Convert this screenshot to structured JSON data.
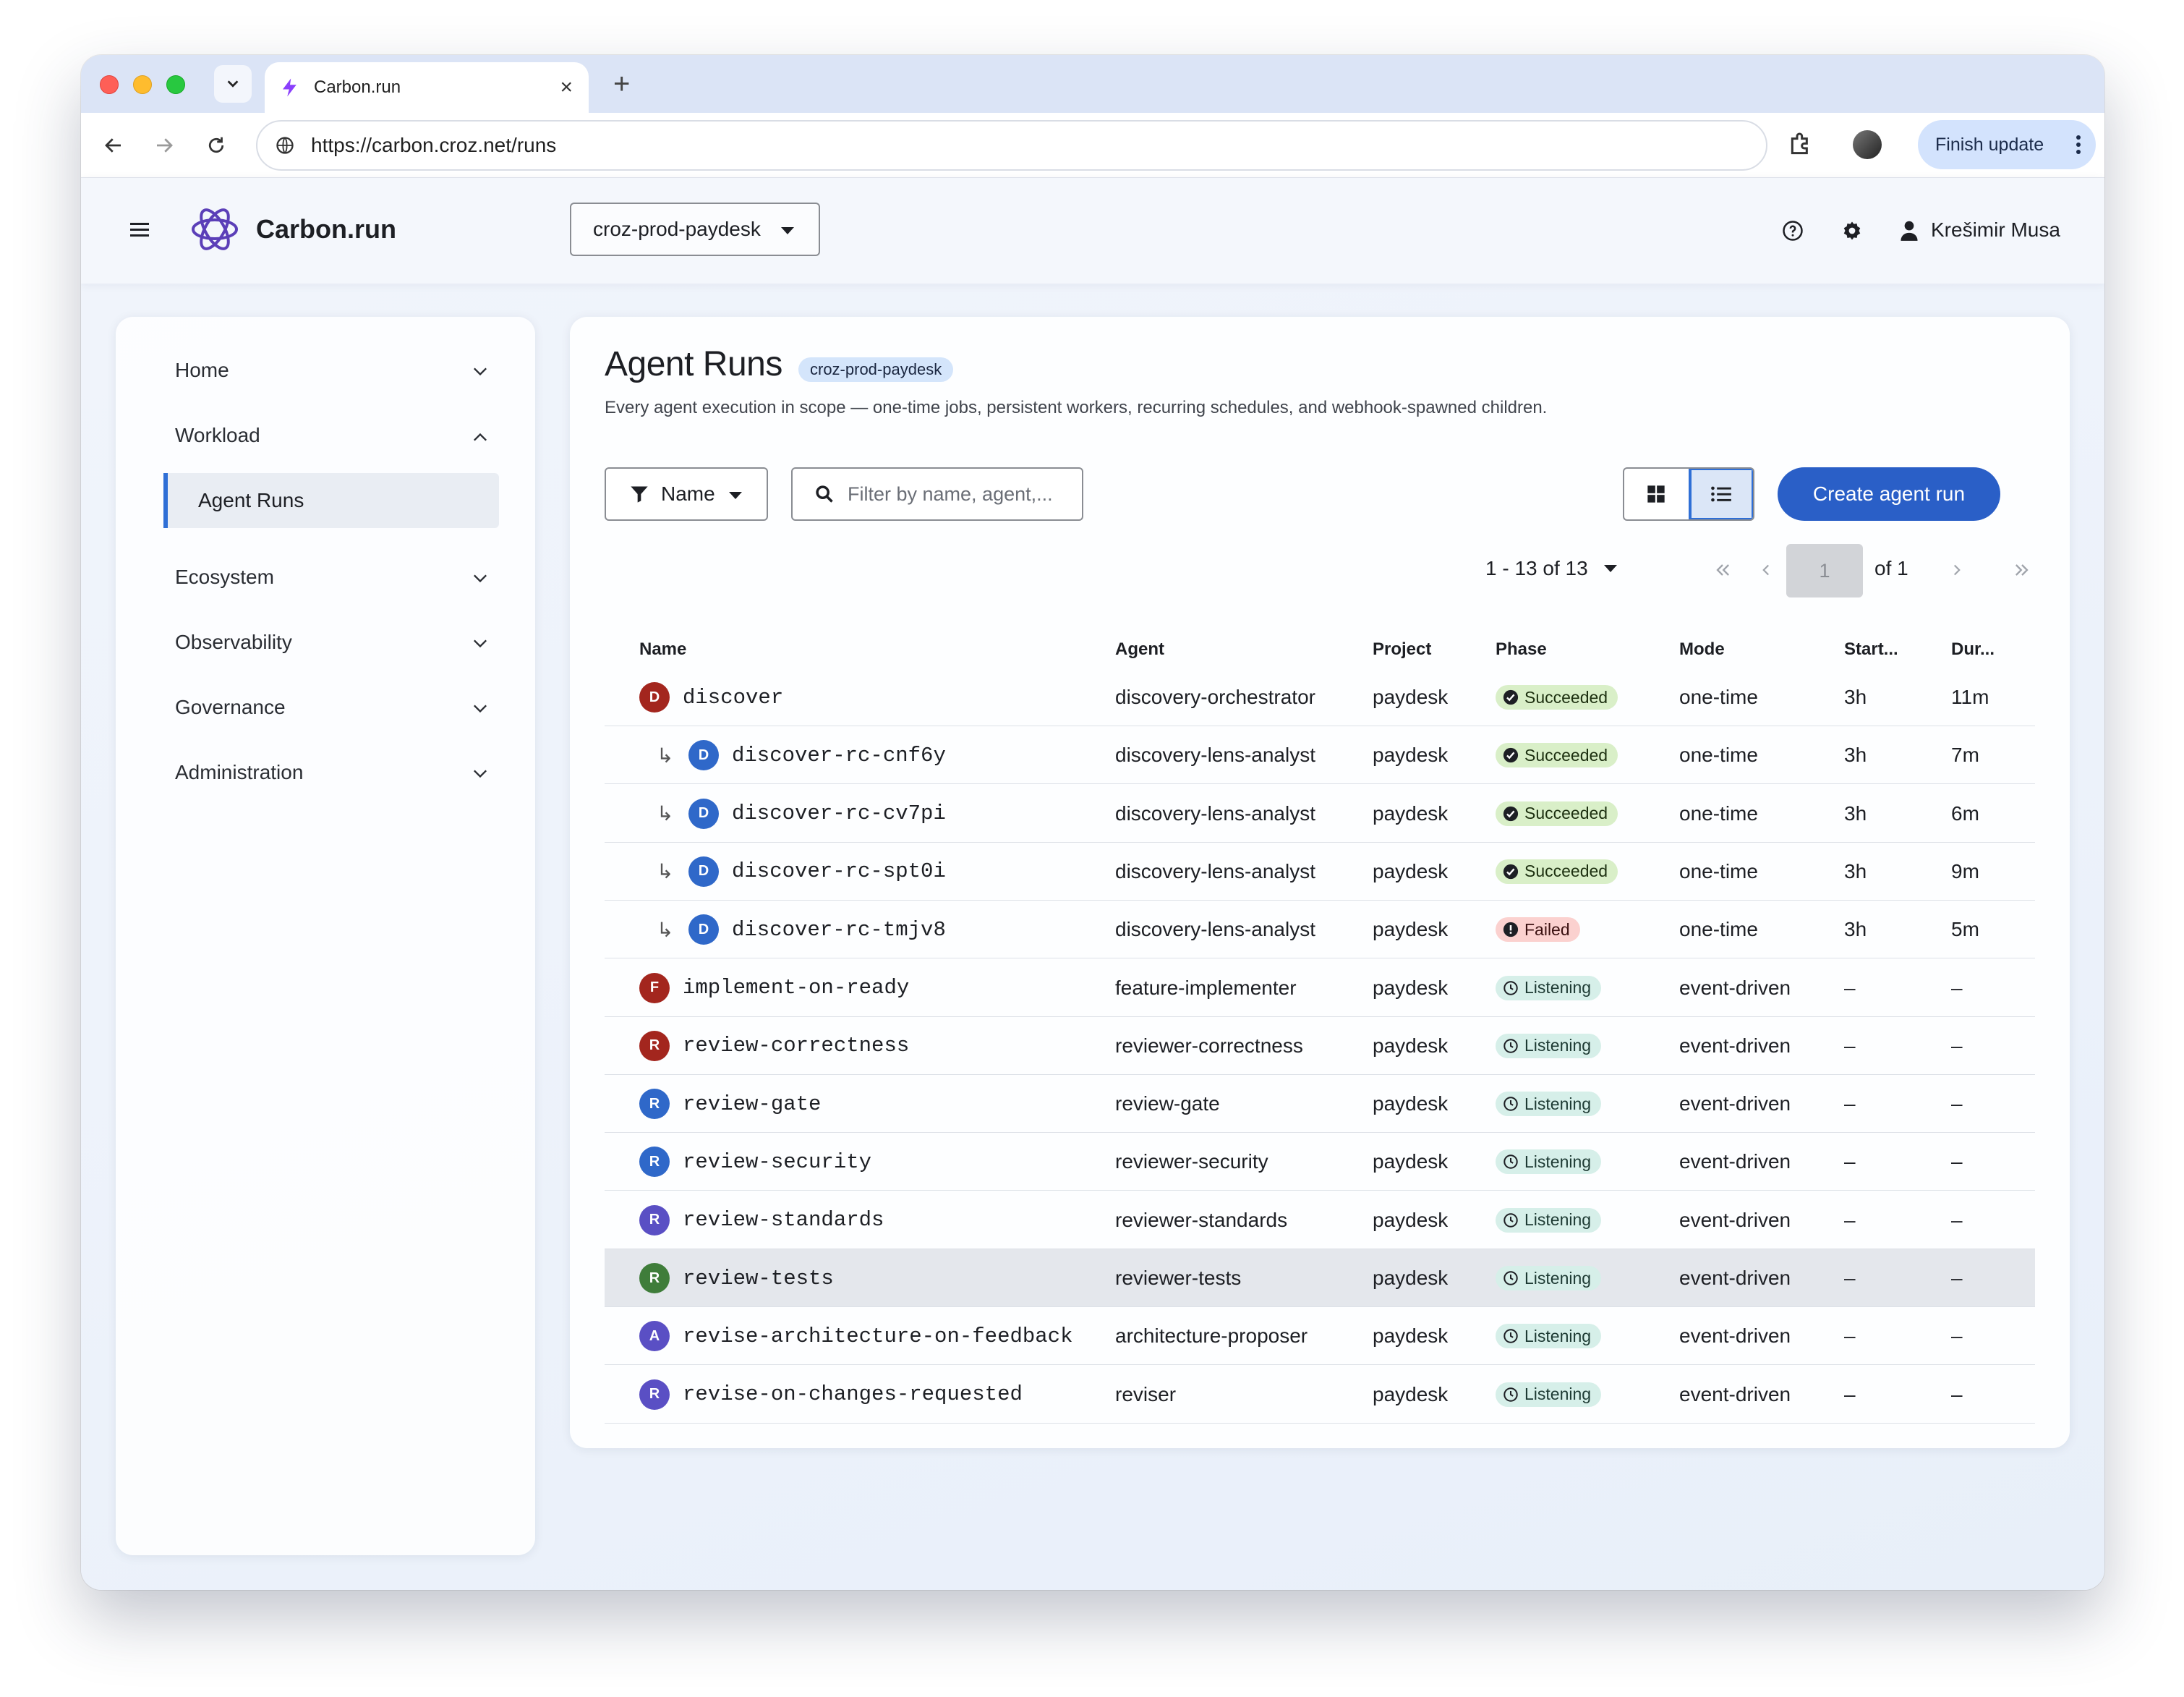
{
  "browser": {
    "tab_title": "Carbon.run",
    "url": "https://carbon.croz.net/runs",
    "finish_update_label": "Finish update"
  },
  "header": {
    "brand": "Carbon.run",
    "project": "croz-prod-paydesk",
    "user_name": "Krešimir Musa"
  },
  "sidebar": {
    "items": [
      {
        "label": "Home",
        "expanded": false
      },
      {
        "label": "Workload",
        "expanded": true
      },
      {
        "label": "Ecosystem",
        "expanded": false
      },
      {
        "label": "Observability",
        "expanded": false
      },
      {
        "label": "Governance",
        "expanded": false
      },
      {
        "label": "Administration",
        "expanded": false
      }
    ],
    "sub_item": "Agent Runs"
  },
  "main": {
    "title": "Agent Runs",
    "scope_badge": "croz-prod-paydesk",
    "description": "Every agent execution in scope — one-time jobs, persistent workers, recurring schedules, and webhook-spawned children.",
    "filter_label": "Name",
    "search_placeholder": "Filter by name, agent,...",
    "create_button": "Create agent run",
    "pagination": {
      "range": "1 - 13 of 13",
      "page": "1",
      "of": "of 1"
    },
    "columns": [
      "Name",
      "Agent",
      "Project",
      "Phase",
      "Mode",
      "Start...",
      "Dur..."
    ],
    "rows": [
      {
        "name": "discover",
        "child": false,
        "initial": "D",
        "avatar_color": "#a3261e",
        "agent": "discovery-orchestrator",
        "project": "paydesk",
        "phase": "Succeeded",
        "mode": "one-time",
        "start": "3h",
        "duration": "11m"
      },
      {
        "name": "discover-rc-cnf6y",
        "child": true,
        "initial": "D",
        "avatar_color": "#2f68c9",
        "agent": "discovery-lens-analyst",
        "project": "paydesk",
        "phase": "Succeeded",
        "mode": "one-time",
        "start": "3h",
        "duration": "7m"
      },
      {
        "name": "discover-rc-cv7pi",
        "child": true,
        "initial": "D",
        "avatar_color": "#2f68c9",
        "agent": "discovery-lens-analyst",
        "project": "paydesk",
        "phase": "Succeeded",
        "mode": "one-time",
        "start": "3h",
        "duration": "6m"
      },
      {
        "name": "discover-rc-spt0i",
        "child": true,
        "initial": "D",
        "avatar_color": "#2f68c9",
        "agent": "discovery-lens-analyst",
        "project": "paydesk",
        "phase": "Succeeded",
        "mode": "one-time",
        "start": "3h",
        "duration": "9m"
      },
      {
        "name": "discover-rc-tmjv8",
        "child": true,
        "initial": "D",
        "avatar_color": "#2f68c9",
        "agent": "discovery-lens-analyst",
        "project": "paydesk",
        "phase": "Failed",
        "mode": "one-time",
        "start": "3h",
        "duration": "5m"
      },
      {
        "name": "implement-on-ready",
        "child": false,
        "initial": "F",
        "avatar_color": "#a3261e",
        "agent": "feature-implementer",
        "project": "paydesk",
        "phase": "Listening",
        "mode": "event-driven",
        "start": "–",
        "duration": "–"
      },
      {
        "name": "review-correctness",
        "child": false,
        "initial": "R",
        "avatar_color": "#a3261e",
        "agent": "reviewer-correctness",
        "project": "paydesk",
        "phase": "Listening",
        "mode": "event-driven",
        "start": "–",
        "duration": "–"
      },
      {
        "name": "review-gate",
        "child": false,
        "initial": "R",
        "avatar_color": "#2f68c9",
        "agent": "review-gate",
        "project": "paydesk",
        "phase": "Listening",
        "mode": "event-driven",
        "start": "–",
        "duration": "–"
      },
      {
        "name": "review-security",
        "child": false,
        "initial": "R",
        "avatar_color": "#2f68c9",
        "agent": "reviewer-security",
        "project": "paydesk",
        "phase": "Listening",
        "mode": "event-driven",
        "start": "–",
        "duration": "–"
      },
      {
        "name": "review-standards",
        "child": false,
        "initial": "R",
        "avatar_color": "#5a4fc4",
        "agent": "reviewer-standards",
        "project": "paydesk",
        "phase": "Listening",
        "mode": "event-driven",
        "start": "–",
        "duration": "–"
      },
      {
        "name": "review-tests",
        "child": false,
        "initial": "R",
        "avatar_color": "#3f7d3a",
        "agent": "reviewer-tests",
        "project": "paydesk",
        "phase": "Listening",
        "mode": "event-driven",
        "start": "–",
        "duration": "–",
        "highlighted": true
      },
      {
        "name": "revise-architecture-on-feedback",
        "child": false,
        "initial": "A",
        "avatar_color": "#5a4fc4",
        "agent": "architecture-proposer",
        "project": "paydesk",
        "phase": "Listening",
        "mode": "event-driven",
        "start": "–",
        "duration": "–"
      },
      {
        "name": "revise-on-changes-requested",
        "child": false,
        "initial": "R",
        "avatar_color": "#5a4fc4",
        "agent": "reviser",
        "project": "paydesk",
        "phase": "Listening",
        "mode": "event-driven",
        "start": "–",
        "duration": "–"
      }
    ]
  }
}
